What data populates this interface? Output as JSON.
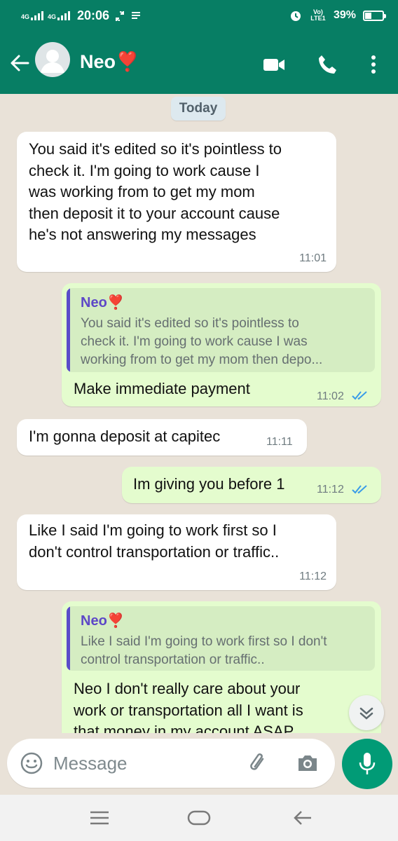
{
  "status_bar": {
    "network_1": "4G",
    "network_2": "4G",
    "time": "20:06",
    "volte": "Vo) LTE1",
    "battery_percent": "39%",
    "battery_level": 0.39
  },
  "header": {
    "contact_name": "Neo❣️",
    "video_call_icon": "video-call-icon",
    "voice_call_icon": "phone-icon",
    "menu_icon": "more-vert-icon"
  },
  "chat": {
    "date_chip": "Today",
    "messages": [
      {
        "direction": "in",
        "text": "You said it's edited so it's pointless to\ncheck it. I'm going to work cause I\nwas working from to get my mom\nthen deposit it to your account cause\nhe's not answering my messages",
        "time": "11:01"
      },
      {
        "direction": "out",
        "quote_name": "Neo❣️",
        "quote_text": "You said it's edited so it's pointless to\ncheck it. I'm going to work cause I was\nworking from to get my mom then depo...",
        "text": "Make immediate payment",
        "time": "11:02",
        "status": "read"
      },
      {
        "direction": "in",
        "text": "I'm gonna deposit at capitec",
        "time": "11:11"
      },
      {
        "direction": "out",
        "text": "Im giving you before 1",
        "time": "11:12",
        "status": "read"
      },
      {
        "direction": "in",
        "text": "Like I said I'm going to work first so I\ndon't control transportation or traffic..",
        "time": "11:12"
      },
      {
        "direction": "out",
        "quote_name": "Neo❣️",
        "quote_text": "Like I said I'm going to work first so I don't\ncontrol transportation or traffic..",
        "text": "Neo I don't really care about your\nwork or transportation all I want is\nthat money in my account ASAP"
      }
    ]
  },
  "composer": {
    "placeholder": "Message",
    "emoji_icon": "emoji-icon",
    "attach_icon": "paperclip-icon",
    "camera_icon": "camera-icon",
    "mic_icon": "mic-icon"
  },
  "colors": {
    "header": "#077e64",
    "incoming_bubble": "#ffffff",
    "outgoing_bubble": "#e4fcce",
    "read_ticks": "#3a9ce8",
    "mic_button": "#019b76"
  }
}
